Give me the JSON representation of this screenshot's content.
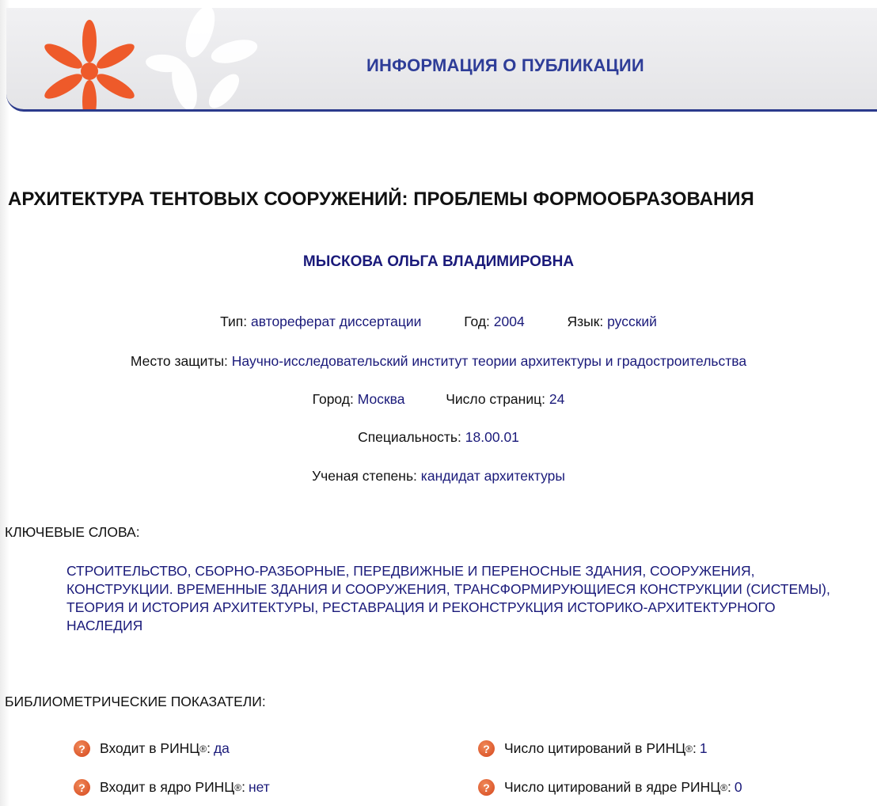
{
  "header": {
    "title": "ИНФОРМАЦИЯ О ПУБЛИКАЦИИ",
    "logo_icon": "elibrary-flower-logo-icon",
    "colors": {
      "accent": "#2e3d98",
      "logo_orange": "#ee5a2a"
    }
  },
  "publication": {
    "title": "АРХИТЕКТУРА ТЕНТОВЫХ СООРУЖЕНИЙ: ПРОБЛЕМЫ ФОРМООБРАЗОВАНИЯ",
    "author": "МЫСКОВА ОЛЬГА ВЛАДИМИРОВНА",
    "type_label": "Тип:",
    "type_value": "автореферат диссертации",
    "year_label": "Год:",
    "year_value": "2004",
    "lang_label": "Язык:",
    "lang_value": "русский",
    "place_label": "Место защиты:",
    "place_value": "Научно-исследовательский институт теории архитектуры и градостроительства",
    "city_label": "Город:",
    "city_value": "Москва",
    "pages_label": "Число страниц:",
    "pages_value": "24",
    "spec_label": "Специальность:",
    "spec_value": "18.00.01",
    "degree_label": "Ученая степень:",
    "degree_value": "кандидат архитектуры"
  },
  "keywords": {
    "label": "КЛЮЧЕВЫЕ СЛОВА:",
    "text": "СТРОИТЕЛЬСТВО, СБОРНО-РАЗБОРНЫЕ, ПЕРЕДВИЖНЫЕ И ПЕРЕНОСНЫЕ ЗДАНИЯ, СООРУЖЕНИЯ, КОНСТРУКЦИИ. ВРЕМЕННЫЕ ЗДАНИЯ И СООРУЖЕНИЯ, ТРАНСФОРМИРУЮЩИЕСЯ КОНСТРУКЦИИ (СИСТЕМЫ), ТЕОРИЯ И ИСТОРИЯ АРХИТЕКТУРЫ, РЕСТАВРАЦИЯ И РЕКОНСТРУКЦИЯ ИСТОРИКО-АРХИТЕКТУРНОГО НАСЛЕДИЯ"
  },
  "bibliometrics": {
    "label": "БИБЛИОМЕТРИЧЕСКИЕ ПОКАЗАТЕЛИ:",
    "help_icon": "question-help-icon",
    "items": [
      {
        "label": "Входит в РИНЦ",
        "sup": "®",
        "suffix": ":",
        "value": "да"
      },
      {
        "label": "Число цитирований в РИНЦ",
        "sup": "®",
        "suffix": ":",
        "value": "1"
      },
      {
        "label": "Входит в ядро РИНЦ",
        "sup": "®",
        "suffix": ":",
        "value": "нет"
      },
      {
        "label": "Число цитирований в ядре РИНЦ",
        "sup": "®",
        "suffix": ":",
        "value": "0"
      }
    ]
  }
}
